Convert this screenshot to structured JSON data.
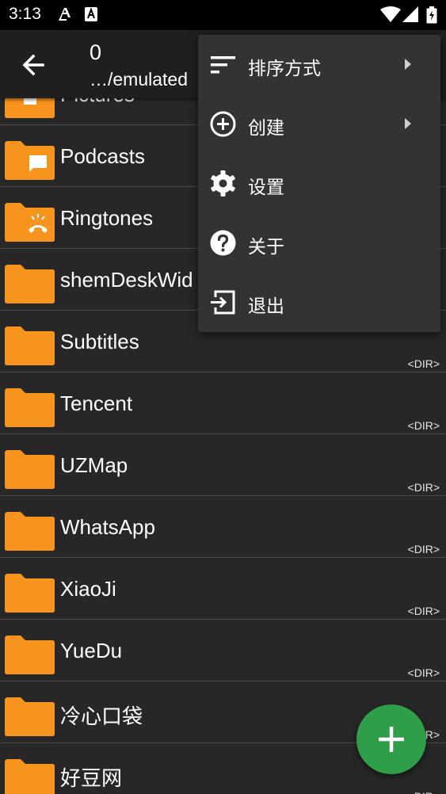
{
  "status_bar": {
    "time": "3:13",
    "icons": [
      "autofill-icon",
      "text-a-icon",
      "wifi-icon",
      "cellular-signal-icon",
      "battery-charging-icon"
    ]
  },
  "toolbar": {
    "title": "0",
    "subtitle": "…/emulated",
    "back_icon": "arrow-back-icon"
  },
  "files": [
    {
      "name": "Pictures",
      "type": "",
      "icon": "folder-pictures-icon"
    },
    {
      "name": "Podcasts",
      "type": "",
      "icon": "folder-podcast-icon"
    },
    {
      "name": "Ringtones",
      "type": "",
      "icon": "folder-ringtone-icon"
    },
    {
      "name": "shemDeskWid",
      "type": "",
      "icon": "folder-icon"
    },
    {
      "name": "Subtitles",
      "type": "<DIR>",
      "icon": "folder-icon"
    },
    {
      "name": "Tencent",
      "type": "<DIR>",
      "icon": "folder-icon"
    },
    {
      "name": "UZMap",
      "type": "<DIR>",
      "icon": "folder-icon"
    },
    {
      "name": "WhatsApp",
      "type": "<DIR>",
      "icon": "folder-icon"
    },
    {
      "name": "XiaoJi",
      "type": "<DIR>",
      "icon": "folder-icon"
    },
    {
      "name": "YueDu",
      "type": "<DIR>",
      "icon": "folder-icon"
    },
    {
      "name": "冷心口袋",
      "type": "<DIR>",
      "icon": "folder-icon"
    },
    {
      "name": "好豆网",
      "type": "<DIR>",
      "icon": "folder-icon"
    }
  ],
  "menu": {
    "items": [
      {
        "label": "排序方式",
        "icon": "sort-icon",
        "has_submenu": true
      },
      {
        "label": "创建",
        "icon": "add-circle-icon",
        "has_submenu": true
      },
      {
        "label": "设置",
        "icon": "settings-gear-icon",
        "has_submenu": false
      },
      {
        "label": "关于",
        "icon": "help-circle-icon",
        "has_submenu": false
      },
      {
        "label": "退出",
        "icon": "exit-icon",
        "has_submenu": false
      }
    ]
  },
  "fab": {
    "icon": "add-icon"
  },
  "colors": {
    "background": "#272727",
    "toolbar": "#1f1f1f",
    "menu": "#333333",
    "folder": "#f7941d",
    "fab": "#2e9e48",
    "divider": "#4a4a4a"
  }
}
